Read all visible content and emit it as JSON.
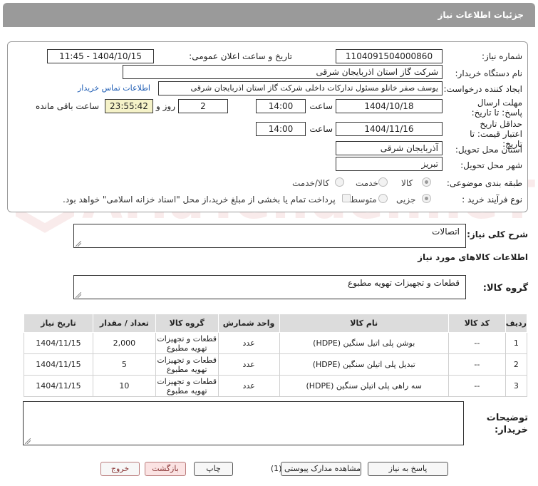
{
  "page": {
    "title": "جزئیات اطلاعات نیاز"
  },
  "form": {
    "need_number": {
      "label": "شماره نیاز:",
      "value": "1104091504000860"
    },
    "announce_datetime": {
      "label": "تاریخ و ساعت اعلان عمومی:",
      "value": "1404/10/15 - 11:45"
    },
    "buyer_org": {
      "label": "نام دستگاه خریدار:",
      "value": "شرکت گاز استان اذربایجان شرقی"
    },
    "requester": {
      "label": "ایجاد کننده درخواست:",
      "value": "یوسف صفر خانلو  مسئول تدارکات داخلی  شرکت گاز استان اذربایجان شرقی"
    },
    "buyer_contact_link": "اطلاعات تماس خریدار",
    "reply_deadline": {
      "label": "مهلت ارسال پاسخ: تا تاریخ:",
      "date": "1404/10/18",
      "time_label": "ساعت",
      "time": "14:00",
      "days": "2",
      "days_label": "روز و",
      "remaining": "23:55:42",
      "remaining_label": "ساعت باقی مانده"
    },
    "price_validity": {
      "label": "حداقل تاریخ اعتبار قیمت: تا تاریخ:",
      "date": "1404/11/16",
      "time_label": "ساعت",
      "time": "14:00"
    },
    "delivery_province": {
      "label": "استان محل تحویل:",
      "value": "آذربایجان شرقی"
    },
    "delivery_city": {
      "label": "شهر محل تحویل:",
      "value": "تبریز"
    },
    "category": {
      "label": "طبقه بندی موضوعی:",
      "options": [
        "کالا",
        "خدمت",
        "کالا/خدمت"
      ],
      "selected": "کالا"
    },
    "process_type": {
      "label": "نوع فرآیند خرید :",
      "options": [
        "جزیی",
        "متوسط"
      ],
      "selected": "جزیی",
      "note": "پرداخت تمام یا بخشی از مبلغ خرید،از محل \"اسناد خزانه اسلامی\" خواهد بود."
    }
  },
  "need_description": {
    "label": "شرح کلی نیاز:",
    "value": "اتصالات"
  },
  "goods_section_title": "اطلاعات کالاهای مورد نیاز",
  "goods_group": {
    "label": "گروه کالا:",
    "value": "قطعات و تجهیزات تهویه مطبوع"
  },
  "table": {
    "headers": [
      "ردیف",
      "کد کالا",
      "نام کالا",
      "واحد شمارش",
      "گروه کالا",
      "تعداد / مقدار",
      "تاریخ نیاز"
    ],
    "rows": [
      [
        "1",
        "--",
        "بوشن پلی اتیل سنگین (HDPE)",
        "عدد",
        "قطعات و تجهیزات تهویه مطبوع",
        "2,000",
        "1404/11/15"
      ],
      [
        "2",
        "--",
        "تبدیل پلی اتیلن سنگین (HDPE)",
        "عدد",
        "قطعات و تجهیزات تهویه مطبوع",
        "5",
        "1404/11/15"
      ],
      [
        "3",
        "--",
        "سه راهی پلی اتیلن سنگین (HDPE)",
        "عدد",
        "قطعات و تجهیزات تهویه مطبوع",
        "10",
        "1404/11/15"
      ]
    ]
  },
  "buyer_notes": {
    "label": "توضیحات خریدار:",
    "value": ""
  },
  "buttons": {
    "reply": "پاسخ به نیاز",
    "attachments": "مشاهده مدارک پیوستی (1)",
    "print": "چاپ",
    "back": "بازگشت",
    "exit": "خروج"
  },
  "watermark": "AriaTender.neT",
  "colors": {
    "header": "#9a9a9a",
    "link": "#1f5db4",
    "remaining_bg": "#f5f2c8",
    "watermark": "#d26464"
  }
}
